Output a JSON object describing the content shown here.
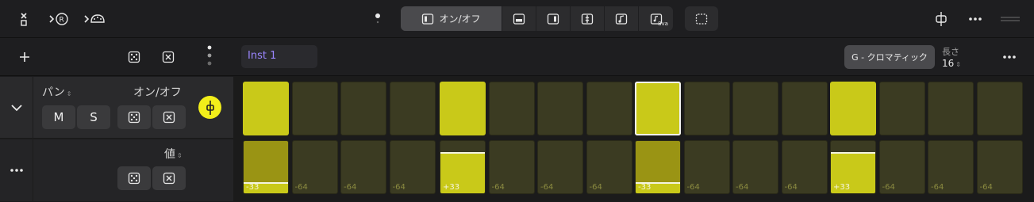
{
  "toolbar": {
    "onoff_label": "オン/オフ",
    "bva_label": "8va"
  },
  "lane_header": {
    "dice_icon": "dice-icon",
    "clear_icon": "clear-icon"
  },
  "rows": {
    "pan": {
      "title": "パン",
      "mode": "オン/オフ",
      "mute_label": "M",
      "solo_label": "S"
    },
    "value": {
      "title": "値"
    }
  },
  "region": {
    "name": "Inst 1",
    "scale": "G - クロマティック",
    "length_label": "長さ",
    "length_value": "16"
  },
  "steps": [
    {
      "on": true,
      "sel": false,
      "value": "-33",
      "level": 0.2
    },
    {
      "on": false,
      "sel": false,
      "value": "-64",
      "level": 0
    },
    {
      "on": false,
      "sel": false,
      "value": "-64",
      "level": 0
    },
    {
      "on": false,
      "sel": false,
      "value": "-64",
      "level": 0
    },
    {
      "on": true,
      "sel": false,
      "value": "+33",
      "level": 0.76
    },
    {
      "on": false,
      "sel": false,
      "value": "-64",
      "level": 0
    },
    {
      "on": false,
      "sel": false,
      "value": "-64",
      "level": 0
    },
    {
      "on": false,
      "sel": false,
      "value": "-64",
      "level": 0
    },
    {
      "on": true,
      "sel": true,
      "value": "-33",
      "level": 0.2
    },
    {
      "on": false,
      "sel": false,
      "value": "-64",
      "level": 0
    },
    {
      "on": false,
      "sel": false,
      "value": "-64",
      "level": 0
    },
    {
      "on": false,
      "sel": false,
      "value": "-64",
      "level": 0
    },
    {
      "on": true,
      "sel": false,
      "value": "+33",
      "level": 0.76
    },
    {
      "on": false,
      "sel": false,
      "value": "-64",
      "level": 0
    },
    {
      "on": false,
      "sel": false,
      "value": "-64",
      "level": 0
    },
    {
      "on": false,
      "sel": false,
      "value": "-64",
      "level": 0
    }
  ],
  "colors": {
    "accent": "#c9c919",
    "step_off": "#3b3b22",
    "region_name": "#9b86ff"
  }
}
